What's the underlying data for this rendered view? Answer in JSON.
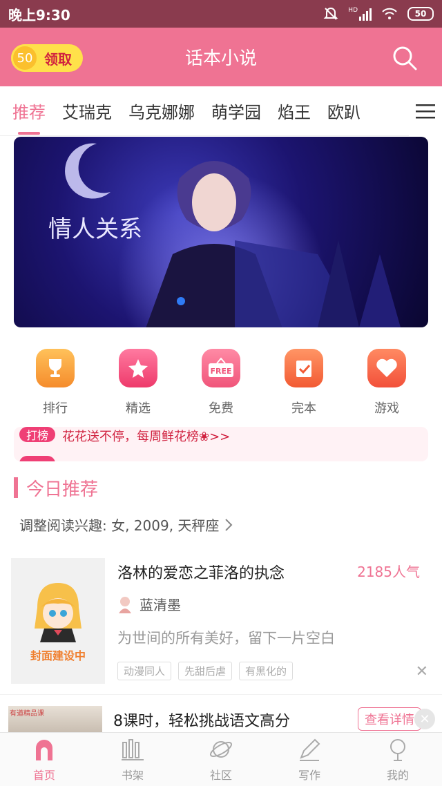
{
  "status_bar": {
    "time": "晚上9:30",
    "battery": "50",
    "signal_label": "HD"
  },
  "header": {
    "coin_value": "50",
    "claim_label": "领取",
    "title": "话本小说"
  },
  "tabs": [
    {
      "label": "推荐",
      "active": true
    },
    {
      "label": "艾瑞克"
    },
    {
      "label": "乌克娜娜"
    },
    {
      "label": "萌学园"
    },
    {
      "label": "焰王"
    },
    {
      "label": "欧趴"
    }
  ],
  "quick_nav": [
    {
      "label": "排行",
      "icon": "trophy-icon",
      "color": "#f6a03a"
    },
    {
      "label": "精选",
      "icon": "star-icon",
      "color": "#f0507c"
    },
    {
      "label": "免费",
      "icon": "free-sign-icon",
      "color": "#f36585"
    },
    {
      "label": "完本",
      "icon": "check-doc-icon",
      "color": "#f47247"
    },
    {
      "label": "游戏",
      "icon": "heart-icon",
      "color": "#f26a49"
    }
  ],
  "notice": {
    "tag": "打榜",
    "text": "花花送不停，每周鲜花榜❀>>"
  },
  "section": {
    "title": "今日推荐",
    "interest": "调整阅读兴趣: 女, 2009, 天秤座"
  },
  "book": {
    "title": "洛林的爱恋之菲洛的执念",
    "popularity": "2185人气",
    "author": "蓝清墨",
    "description": "为世间的所有美好，留下一片空白",
    "tags": [
      "动漫同人",
      "先甜后虐",
      "有黑化的"
    ],
    "cover_text": "封面建设中"
  },
  "ad": {
    "badge": "有道精品课",
    "title": "8课时，轻松挑战语文高分",
    "button": "查看详情"
  },
  "bottom_nav": [
    {
      "label": "首页",
      "active": true
    },
    {
      "label": "书架"
    },
    {
      "label": "社区"
    },
    {
      "label": "写作"
    },
    {
      "label": "我的"
    }
  ],
  "colors": {
    "accent": "#ef7393",
    "status_bar": "#8a3b4e"
  }
}
